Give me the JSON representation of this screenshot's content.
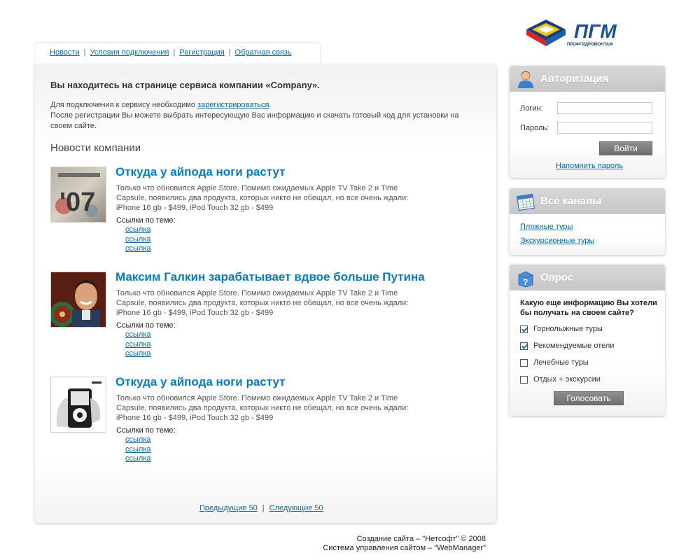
{
  "nav": {
    "items": [
      {
        "label": "Новости"
      },
      {
        "label": "Условия подключения"
      },
      {
        "label": "Регистрация"
      },
      {
        "label": "Обратная связь"
      }
    ],
    "separator": "|"
  },
  "logo": {
    "text": "ПГМ",
    "subtext": "ПРОФГИДРОМОНТАЖ",
    "colors": {
      "red": "#d7262b",
      "blue": "#1d5fa6",
      "yellow": "#f2c417",
      "dark": "#1b3d78"
    }
  },
  "intro": {
    "title": "Вы находитесь на странице сервиса компании «Company».",
    "line1_before": "Для подключения к сервису необходимо ",
    "register_link": "зарегистрироваться",
    "line1_after": ".",
    "line2": "После регистрации Вы можете выбрать интересующую Вас информацию и скачать готовый код для установки на своем сайте."
  },
  "news": {
    "heading": "Новости компании",
    "links_label": "Ссылки по теме:",
    "items": [
      {
        "title": "Откуда у айпода ноги растут",
        "thumb_icon": "album-cover-07-thumbnail",
        "text": "Только что обновился Apple Store. Помимо ожидаемых Apple TV Take 2 и Time Capsule, появились два продукта, которых никто не обещал, но все очень ждали: iPhone 16 gb - $499, iPod Touch 32 gb - $499",
        "links": [
          "ссылка",
          "ссылка",
          "ссылка"
        ]
      },
      {
        "title": "Максим Галкин зарабатывает вдвое больше Путина",
        "thumb_icon": "smiling-man-photo-thumbnail",
        "text": "Только что обновился Apple Store. Помимо ожидаемых Apple TV Take 2 и Time Capsule, появились два продукта, которых никто не обещал, но все очень ждали: iPhone 16 gb - $499, iPod Touch 32 gb - $499",
        "links": [
          "ссылка",
          "ссылка",
          "ссылка"
        ]
      },
      {
        "title": "Откуда у айпода ноги растут",
        "thumb_icon": "ipod-in-hand-thumbnail",
        "text": "Только что обновился Apple Store. Помимо ожидаемых Apple TV Take 2 и Time Capsule, появились два продукта, которых никто не обещал, но все очень ждали: iPhone 16 gb - $499, iPod Touch 32 gb - $499",
        "links": [
          "ссылка",
          "ссылка",
          "ссылка"
        ]
      }
    ]
  },
  "pager": {
    "prev": "Предыдущие 50",
    "separator": "|",
    "next": "Следующие 50"
  },
  "footer": {
    "line1": "Создание сайта – \"Нетсофт\" © 2008",
    "line2": "Система управления сайтом – \"WebManager\""
  },
  "auth": {
    "title": "Авторизация",
    "icon": "user-icon",
    "login_label": "Логин:",
    "login_value": "",
    "password_label": "Пароль:",
    "password_value": "",
    "submit": "Войти",
    "remind": "Напомнить пароль"
  },
  "channels": {
    "title": "Все каналы",
    "icon": "calendar-icon",
    "items": [
      "Пляжные туры",
      "Экскурсионные туры"
    ]
  },
  "poll": {
    "title": "Опрос",
    "icon": "question-box-icon",
    "question": "Какую еще информацию Вы хотели бы получать на своем сайте?",
    "options": [
      {
        "label": "Горнолыжные туры",
        "checked": true
      },
      {
        "label": "Рекомендуемые отели",
        "checked": true
      },
      {
        "label": "Лечебные туры",
        "checked": false
      },
      {
        "label": "Отдых + экскурсии",
        "checked": false
      }
    ],
    "submit": "Голосовать"
  },
  "colors": {
    "link": "#0a6aa8",
    "news_title": "#0a7ab8",
    "box_header": "#c9c9c9",
    "button": "#7c7c7c"
  }
}
